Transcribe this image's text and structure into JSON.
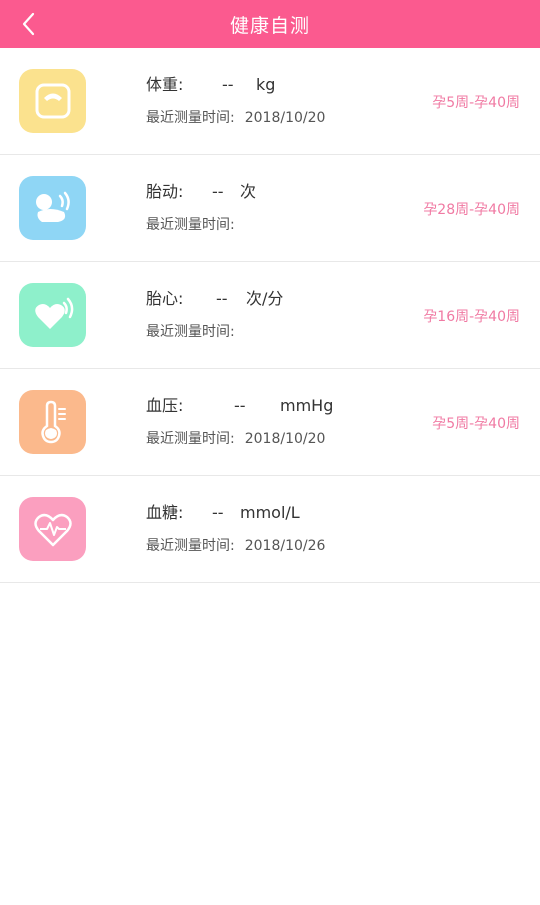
{
  "header": {
    "title": "健康自测"
  },
  "colors": {
    "accent": "#fb5a8f",
    "period_text": "#f07aa3"
  },
  "items": [
    {
      "icon": "scale-icon",
      "icon_bg": "#fbe28e",
      "label": "体重:",
      "value": "--",
      "unit": "kg",
      "time_label": "最近测量时间:",
      "time": "2018/10/20",
      "period": "孕5周-孕40周"
    },
    {
      "icon": "fetal-movement-icon",
      "icon_bg": "#8fd6f5",
      "label": "胎动:",
      "value": "--",
      "unit": "次",
      "time_label": "最近测量时间:",
      "time": "",
      "period": "孕28周-孕40周"
    },
    {
      "icon": "fetal-heart-icon",
      "icon_bg": "#8ef0cb",
      "label": "胎心:",
      "value": "--",
      "unit": "次/分",
      "time_label": "最近测量时间:",
      "time": "",
      "period": "孕16周-孕40周"
    },
    {
      "icon": "thermometer-icon",
      "icon_bg": "#fbb98c",
      "label": "血压:",
      "value": "--",
      "unit": "mmHg",
      "time_label": "最近测量时间:",
      "time": "2018/10/20",
      "period": "孕5周-孕40周"
    },
    {
      "icon": "heart-pulse-icon",
      "icon_bg": "#fb9fbf",
      "label": "血糖:",
      "value": "--",
      "unit": "mmol/L",
      "time_label": "最近测量时间:",
      "time": "2018/10/26",
      "period": ""
    }
  ]
}
